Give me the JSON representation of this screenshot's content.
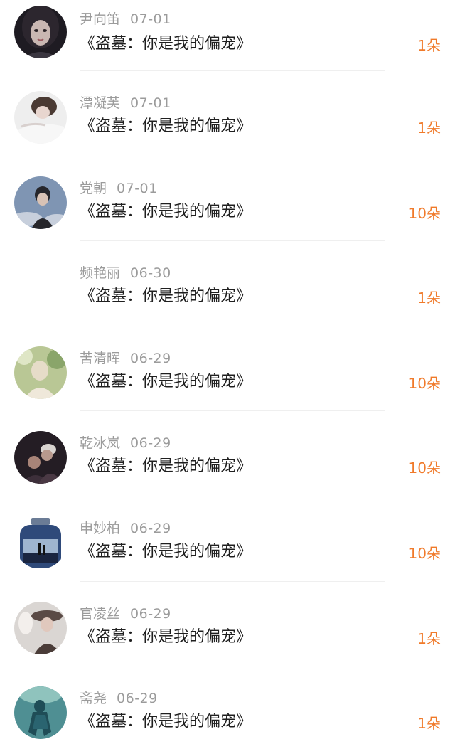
{
  "entries": [
    {
      "name": "尹向笛",
      "date": "07-01",
      "title": "《盗墓：你是我的偏宠》",
      "gift": "1朵",
      "avatar": "avatar-girl-portrait",
      "colors": [
        "#3a3640",
        "#c9b7b2",
        "#1e1b22"
      ]
    },
    {
      "name": "潭凝芙",
      "date": "07-01",
      "title": "《盗墓：你是我的偏宠》",
      "gift": "1朵",
      "avatar": "avatar-girl-lying",
      "colors": [
        "#eeeeee",
        "#4a3a33",
        "#d8d0ce"
      ]
    },
    {
      "name": "党朝",
      "date": "07-01",
      "title": "《盗墓：你是我的偏宠》",
      "gift": "10朵",
      "avatar": "avatar-boy-sky",
      "colors": [
        "#7f95b3",
        "#26262b",
        "#c7cfdc"
      ]
    },
    {
      "name": "频艳丽",
      "date": "06-30",
      "title": "《盗墓：你是我的偏宠》",
      "gift": "1朵",
      "avatar": "",
      "colors": [
        "#ffffff",
        "#ffffff",
        "#ffffff"
      ]
    },
    {
      "name": "苦清晖",
      "date": "06-29",
      "title": "《盗墓：你是我的偏宠》",
      "gift": "10朵",
      "avatar": "avatar-girl-field",
      "colors": [
        "#b9c795",
        "#e6dcc8",
        "#8aa56a"
      ]
    },
    {
      "name": "乾冰岚",
      "date": "06-29",
      "title": "《盗墓：你是我的偏宠》",
      "gift": "10朵",
      "avatar": "avatar-couple",
      "colors": [
        "#241d24",
        "#b8998d",
        "#3d2f3a"
      ]
    },
    {
      "name": "申妙柏",
      "date": "06-29",
      "title": "《盗墓：你是我的偏宠》",
      "gift": "10朵",
      "avatar": "avatar-bottle",
      "colors": [
        "#2f4a7a",
        "#9fb5cf",
        "#1a2540"
      ]
    },
    {
      "name": "官凌丝",
      "date": "06-29",
      "title": "《盗墓：你是我的偏宠》",
      "gift": "1朵",
      "avatar": "avatar-girl-hat",
      "colors": [
        "#dad6d3",
        "#5a4a45",
        "#f3efec"
      ]
    },
    {
      "name": "斋尧",
      "date": "06-29",
      "title": "《盗墓：你是我的偏宠》",
      "gift": "1朵",
      "avatar": "avatar-underwater",
      "colors": [
        "#4f8f93",
        "#1f4d57",
        "#8fc3bd"
      ]
    }
  ]
}
